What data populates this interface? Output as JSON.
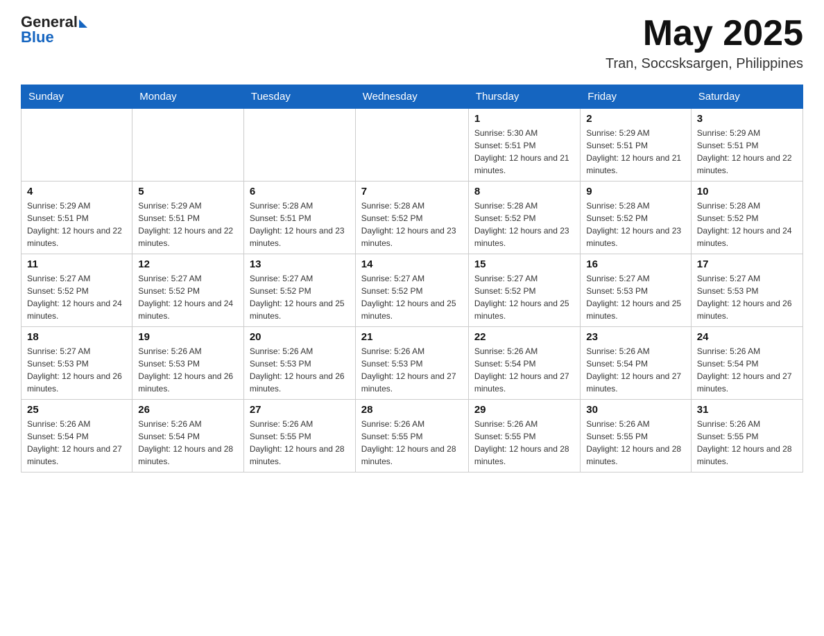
{
  "header": {
    "logo_text_black": "General",
    "logo_text_blue": "Blue",
    "month_title": "May 2025",
    "location": "Tran, Soccsksargen, Philippines"
  },
  "weekdays": [
    "Sunday",
    "Monday",
    "Tuesday",
    "Wednesday",
    "Thursday",
    "Friday",
    "Saturday"
  ],
  "weeks": [
    [
      {
        "day": "",
        "sunrise": "",
        "sunset": "",
        "daylight": ""
      },
      {
        "day": "",
        "sunrise": "",
        "sunset": "",
        "daylight": ""
      },
      {
        "day": "",
        "sunrise": "",
        "sunset": "",
        "daylight": ""
      },
      {
        "day": "",
        "sunrise": "",
        "sunset": "",
        "daylight": ""
      },
      {
        "day": "1",
        "sunrise": "Sunrise: 5:30 AM",
        "sunset": "Sunset: 5:51 PM",
        "daylight": "Daylight: 12 hours and 21 minutes."
      },
      {
        "day": "2",
        "sunrise": "Sunrise: 5:29 AM",
        "sunset": "Sunset: 5:51 PM",
        "daylight": "Daylight: 12 hours and 21 minutes."
      },
      {
        "day": "3",
        "sunrise": "Sunrise: 5:29 AM",
        "sunset": "Sunset: 5:51 PM",
        "daylight": "Daylight: 12 hours and 22 minutes."
      }
    ],
    [
      {
        "day": "4",
        "sunrise": "Sunrise: 5:29 AM",
        "sunset": "Sunset: 5:51 PM",
        "daylight": "Daylight: 12 hours and 22 minutes."
      },
      {
        "day": "5",
        "sunrise": "Sunrise: 5:29 AM",
        "sunset": "Sunset: 5:51 PM",
        "daylight": "Daylight: 12 hours and 22 minutes."
      },
      {
        "day": "6",
        "sunrise": "Sunrise: 5:28 AM",
        "sunset": "Sunset: 5:51 PM",
        "daylight": "Daylight: 12 hours and 23 minutes."
      },
      {
        "day": "7",
        "sunrise": "Sunrise: 5:28 AM",
        "sunset": "Sunset: 5:52 PM",
        "daylight": "Daylight: 12 hours and 23 minutes."
      },
      {
        "day": "8",
        "sunrise": "Sunrise: 5:28 AM",
        "sunset": "Sunset: 5:52 PM",
        "daylight": "Daylight: 12 hours and 23 minutes."
      },
      {
        "day": "9",
        "sunrise": "Sunrise: 5:28 AM",
        "sunset": "Sunset: 5:52 PM",
        "daylight": "Daylight: 12 hours and 23 minutes."
      },
      {
        "day": "10",
        "sunrise": "Sunrise: 5:28 AM",
        "sunset": "Sunset: 5:52 PM",
        "daylight": "Daylight: 12 hours and 24 minutes."
      }
    ],
    [
      {
        "day": "11",
        "sunrise": "Sunrise: 5:27 AM",
        "sunset": "Sunset: 5:52 PM",
        "daylight": "Daylight: 12 hours and 24 minutes."
      },
      {
        "day": "12",
        "sunrise": "Sunrise: 5:27 AM",
        "sunset": "Sunset: 5:52 PM",
        "daylight": "Daylight: 12 hours and 24 minutes."
      },
      {
        "day": "13",
        "sunrise": "Sunrise: 5:27 AM",
        "sunset": "Sunset: 5:52 PM",
        "daylight": "Daylight: 12 hours and 25 minutes."
      },
      {
        "day": "14",
        "sunrise": "Sunrise: 5:27 AM",
        "sunset": "Sunset: 5:52 PM",
        "daylight": "Daylight: 12 hours and 25 minutes."
      },
      {
        "day": "15",
        "sunrise": "Sunrise: 5:27 AM",
        "sunset": "Sunset: 5:52 PM",
        "daylight": "Daylight: 12 hours and 25 minutes."
      },
      {
        "day": "16",
        "sunrise": "Sunrise: 5:27 AM",
        "sunset": "Sunset: 5:53 PM",
        "daylight": "Daylight: 12 hours and 25 minutes."
      },
      {
        "day": "17",
        "sunrise": "Sunrise: 5:27 AM",
        "sunset": "Sunset: 5:53 PM",
        "daylight": "Daylight: 12 hours and 26 minutes."
      }
    ],
    [
      {
        "day": "18",
        "sunrise": "Sunrise: 5:27 AM",
        "sunset": "Sunset: 5:53 PM",
        "daylight": "Daylight: 12 hours and 26 minutes."
      },
      {
        "day": "19",
        "sunrise": "Sunrise: 5:26 AM",
        "sunset": "Sunset: 5:53 PM",
        "daylight": "Daylight: 12 hours and 26 minutes."
      },
      {
        "day": "20",
        "sunrise": "Sunrise: 5:26 AM",
        "sunset": "Sunset: 5:53 PM",
        "daylight": "Daylight: 12 hours and 26 minutes."
      },
      {
        "day": "21",
        "sunrise": "Sunrise: 5:26 AM",
        "sunset": "Sunset: 5:53 PM",
        "daylight": "Daylight: 12 hours and 27 minutes."
      },
      {
        "day": "22",
        "sunrise": "Sunrise: 5:26 AM",
        "sunset": "Sunset: 5:54 PM",
        "daylight": "Daylight: 12 hours and 27 minutes."
      },
      {
        "day": "23",
        "sunrise": "Sunrise: 5:26 AM",
        "sunset": "Sunset: 5:54 PM",
        "daylight": "Daylight: 12 hours and 27 minutes."
      },
      {
        "day": "24",
        "sunrise": "Sunrise: 5:26 AM",
        "sunset": "Sunset: 5:54 PM",
        "daylight": "Daylight: 12 hours and 27 minutes."
      }
    ],
    [
      {
        "day": "25",
        "sunrise": "Sunrise: 5:26 AM",
        "sunset": "Sunset: 5:54 PM",
        "daylight": "Daylight: 12 hours and 27 minutes."
      },
      {
        "day": "26",
        "sunrise": "Sunrise: 5:26 AM",
        "sunset": "Sunset: 5:54 PM",
        "daylight": "Daylight: 12 hours and 28 minutes."
      },
      {
        "day": "27",
        "sunrise": "Sunrise: 5:26 AM",
        "sunset": "Sunset: 5:55 PM",
        "daylight": "Daylight: 12 hours and 28 minutes."
      },
      {
        "day": "28",
        "sunrise": "Sunrise: 5:26 AM",
        "sunset": "Sunset: 5:55 PM",
        "daylight": "Daylight: 12 hours and 28 minutes."
      },
      {
        "day": "29",
        "sunrise": "Sunrise: 5:26 AM",
        "sunset": "Sunset: 5:55 PM",
        "daylight": "Daylight: 12 hours and 28 minutes."
      },
      {
        "day": "30",
        "sunrise": "Sunrise: 5:26 AM",
        "sunset": "Sunset: 5:55 PM",
        "daylight": "Daylight: 12 hours and 28 minutes."
      },
      {
        "day": "31",
        "sunrise": "Sunrise: 5:26 AM",
        "sunset": "Sunset: 5:55 PM",
        "daylight": "Daylight: 12 hours and 28 minutes."
      }
    ]
  ]
}
